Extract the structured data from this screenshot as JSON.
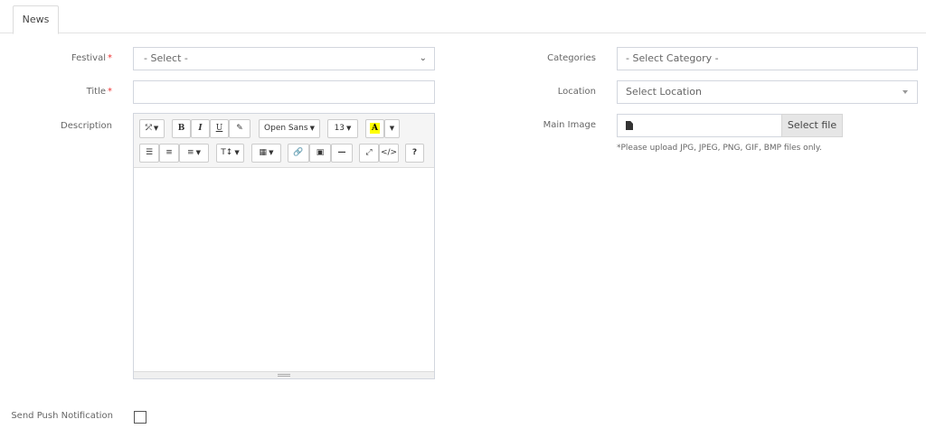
{
  "tabs": [
    {
      "label": "News"
    }
  ],
  "form": {
    "festival": {
      "label": "Festival",
      "required_mark": "*",
      "value": "- Select -"
    },
    "title": {
      "label": "Title",
      "required_mark": "*",
      "value": ""
    },
    "description": {
      "label": "Description",
      "toolbar": {
        "font_family": "Open Sans",
        "font_size": "13",
        "color_letter": "A",
        "help": "?"
      }
    },
    "categories": {
      "label": "Categories",
      "placeholder": "- Select Category -"
    },
    "location": {
      "label": "Location",
      "placeholder": "Select Location"
    },
    "main_image": {
      "label": "Main Image",
      "button": "Select file",
      "hint": "*Please upload JPG, JPEG, PNG, GIF, BMP files only."
    },
    "push": {
      "label": "Send Push Notification",
      "checked": false
    }
  }
}
